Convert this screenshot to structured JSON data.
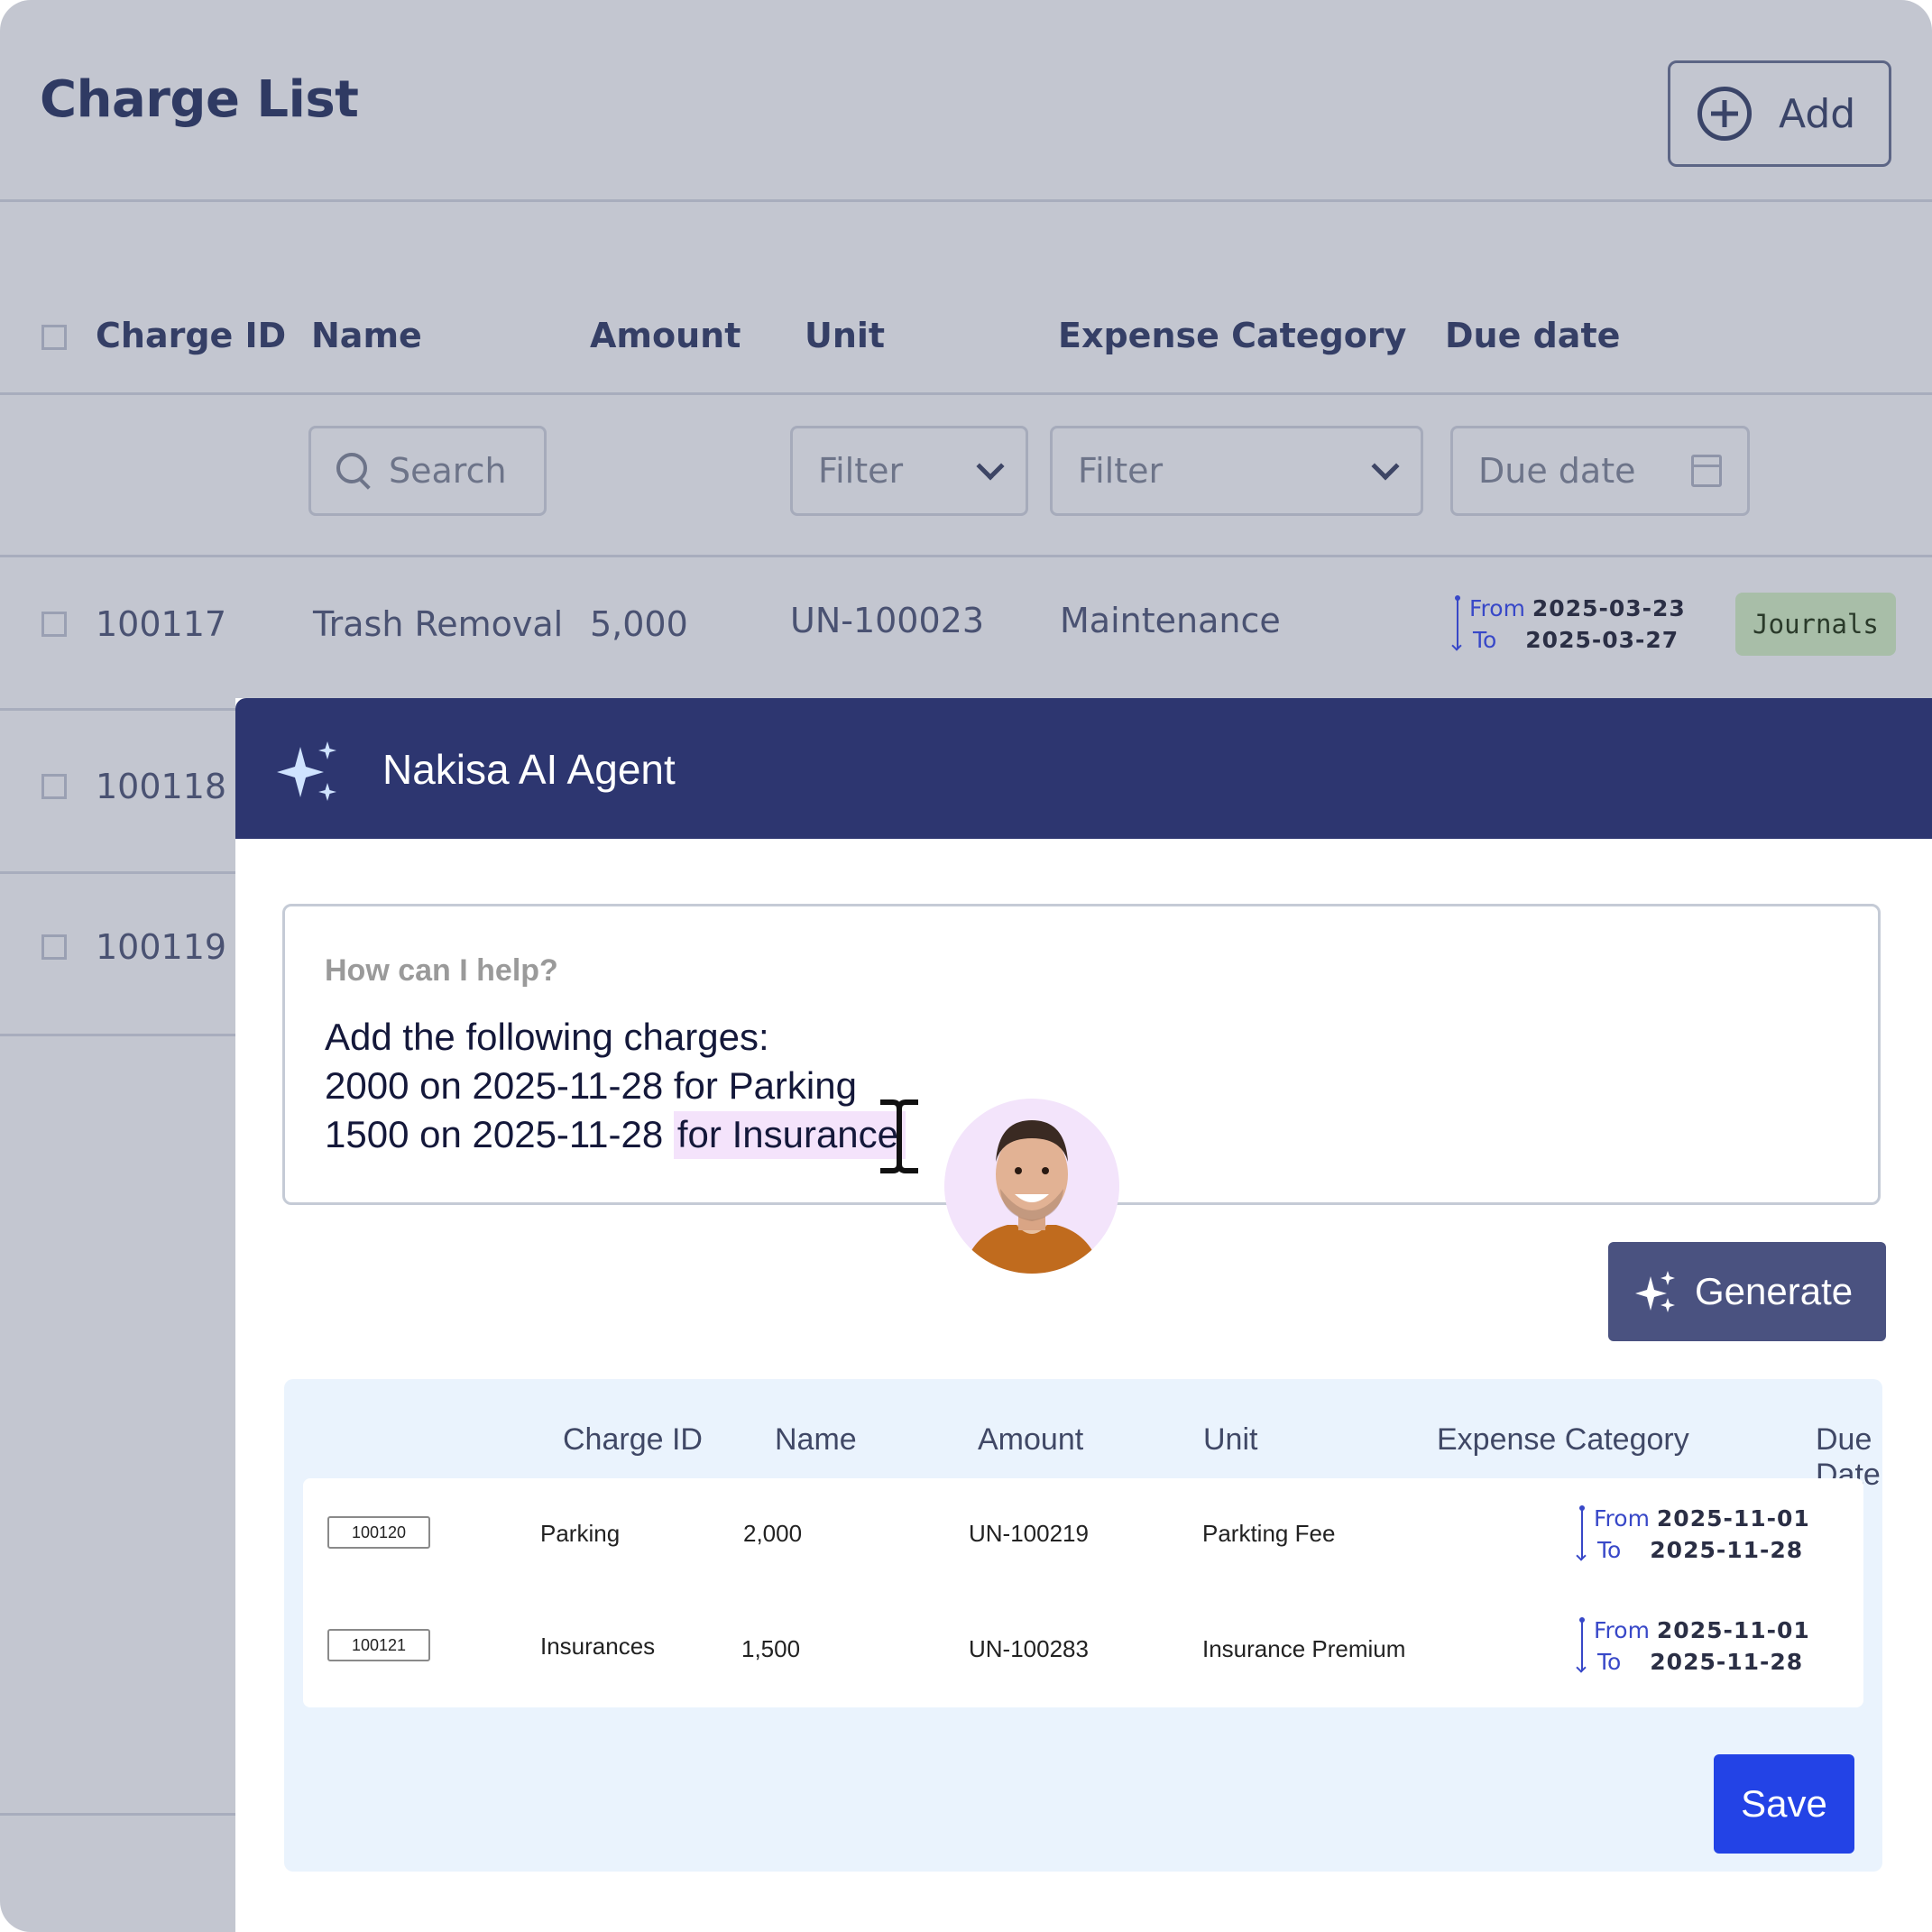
{
  "header": {
    "title": "Charge List",
    "add_label": "Add"
  },
  "columns": [
    "Charge ID",
    "Name",
    "Amount",
    "Unit",
    "Expense Category",
    "Due date"
  ],
  "filters": {
    "name_placeholder": "Search",
    "unit_placeholder": "Filter",
    "category_placeholder": "Filter",
    "due_placeholder": "Due date"
  },
  "rows": [
    {
      "id": "100117",
      "name": "Trash Removal",
      "amount": "5,000",
      "unit": "UN-100023",
      "category": "Maintenance",
      "from_label": "From",
      "from": "2025-03-23",
      "to_label": "To",
      "to": "2025-03-27",
      "tag": "Journals"
    },
    {
      "id": "100118"
    },
    {
      "id": "100119"
    }
  ],
  "agent": {
    "title": "Nakisa AI Agent",
    "prompt_placeholder": "How can I help?",
    "prompt_line1": "Add the following charges:",
    "prompt_line2": "2000 on 2025-11-28 for Parking",
    "prompt_line3a": "1500 on 2025-11-28 ",
    "prompt_line3b": "for Insurance",
    "generate_label": "Generate",
    "save_label": "Save",
    "result_columns": [
      "Charge ID",
      "Name",
      "Amount",
      "Unit",
      "Expense Category",
      "Due Date"
    ],
    "result_rows": [
      {
        "id": "100120",
        "name": "Parking",
        "amount": "2,000",
        "unit": "UN-100219",
        "category": "Parkting Fee",
        "from_label": "From",
        "from": "2025-11-01",
        "to_label": "To",
        "to": "2025-11-28"
      },
      {
        "id": "100121",
        "name": "Insurances",
        "amount": "1,500",
        "unit": "UN-100283",
        "category": "Insurance Premium",
        "from_label": "From",
        "from": "2025-11-01",
        "to_label": "To",
        "to": "2025-11-28"
      }
    ]
  },
  "colors": {
    "background_dim": "#c3c6d0",
    "panel_header": "#2d3670",
    "generate_button": "#4a5280",
    "save_button": "#2343e6",
    "highlight": "#f4e3fb",
    "tag": "#a8bea8"
  },
  "icons": [
    "plus-circle-icon",
    "search-icon",
    "chevron-down-icon",
    "calendar-icon",
    "sparkle-icon",
    "text-cursor-icon",
    "user-avatar"
  ]
}
